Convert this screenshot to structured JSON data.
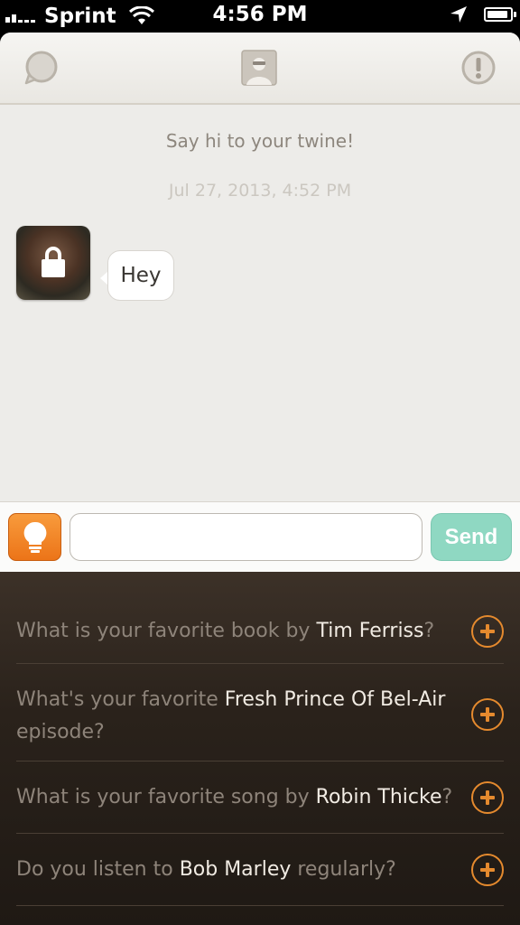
{
  "status_bar": {
    "carrier": "Sprint",
    "time": "4:56 PM"
  },
  "nav": {
    "left_icon": "chat-bubble-icon",
    "center_icon": "profile-card-icon",
    "right_icon": "alert-icon"
  },
  "chat": {
    "intro": "Say hi to your twine!",
    "timestamp": "Jul 27, 2013, 4:52 PM",
    "messages": [
      {
        "text": "Hey",
        "avatar_locked": true
      }
    ]
  },
  "composer": {
    "hint_icon": "lightbulb-icon",
    "input_value": "",
    "input_placeholder": "",
    "send_label": "Send"
  },
  "suggestions": [
    {
      "parts": [
        {
          "t": "What is your favorite book by ",
          "hl": false
        },
        {
          "t": "Tim Ferriss",
          "hl": true
        },
        {
          "t": "?",
          "hl": false
        }
      ]
    },
    {
      "parts": [
        {
          "t": "What's your favorite ",
          "hl": false
        },
        {
          "t": "Fresh Prince Of Bel-Air",
          "hl": true
        },
        {
          "t": " episode?",
          "hl": false
        }
      ]
    },
    {
      "parts": [
        {
          "t": "What is your favorite song by ",
          "hl": false
        },
        {
          "t": "Robin Thicke",
          "hl": true
        },
        {
          "t": "?",
          "hl": false
        }
      ]
    },
    {
      "parts": [
        {
          "t": "Do you listen to ",
          "hl": false
        },
        {
          "t": "Bob Marley",
          "hl": true
        },
        {
          "t": " regularly?",
          "hl": false
        }
      ]
    }
  ],
  "colors": {
    "accent_orange": "#ec7418",
    "send_teal": "#8fd8c2",
    "suggestion_bg": "#2a221b"
  }
}
